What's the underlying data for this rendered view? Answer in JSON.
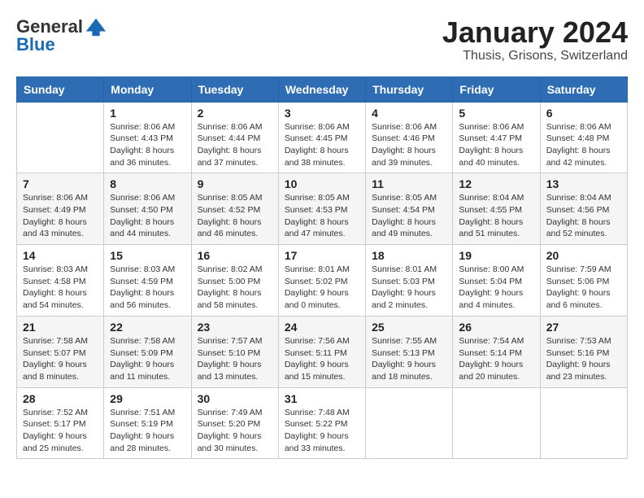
{
  "header": {
    "logo_general": "General",
    "logo_blue": "Blue",
    "month_title": "January 2024",
    "subtitle": "Thusis, Grisons, Switzerland"
  },
  "days_of_week": [
    "Sunday",
    "Monday",
    "Tuesday",
    "Wednesday",
    "Thursday",
    "Friday",
    "Saturday"
  ],
  "weeks": [
    [
      {
        "day": "",
        "sunrise": "",
        "sunset": "",
        "daylight": ""
      },
      {
        "day": "1",
        "sunrise": "Sunrise: 8:06 AM",
        "sunset": "Sunset: 4:43 PM",
        "daylight": "Daylight: 8 hours and 36 minutes."
      },
      {
        "day": "2",
        "sunrise": "Sunrise: 8:06 AM",
        "sunset": "Sunset: 4:44 PM",
        "daylight": "Daylight: 8 hours and 37 minutes."
      },
      {
        "day": "3",
        "sunrise": "Sunrise: 8:06 AM",
        "sunset": "Sunset: 4:45 PM",
        "daylight": "Daylight: 8 hours and 38 minutes."
      },
      {
        "day": "4",
        "sunrise": "Sunrise: 8:06 AM",
        "sunset": "Sunset: 4:46 PM",
        "daylight": "Daylight: 8 hours and 39 minutes."
      },
      {
        "day": "5",
        "sunrise": "Sunrise: 8:06 AM",
        "sunset": "Sunset: 4:47 PM",
        "daylight": "Daylight: 8 hours and 40 minutes."
      },
      {
        "day": "6",
        "sunrise": "Sunrise: 8:06 AM",
        "sunset": "Sunset: 4:48 PM",
        "daylight": "Daylight: 8 hours and 42 minutes."
      }
    ],
    [
      {
        "day": "7",
        "sunrise": "Sunrise: 8:06 AM",
        "sunset": "Sunset: 4:49 PM",
        "daylight": "Daylight: 8 hours and 43 minutes."
      },
      {
        "day": "8",
        "sunrise": "Sunrise: 8:06 AM",
        "sunset": "Sunset: 4:50 PM",
        "daylight": "Daylight: 8 hours and 44 minutes."
      },
      {
        "day": "9",
        "sunrise": "Sunrise: 8:05 AM",
        "sunset": "Sunset: 4:52 PM",
        "daylight": "Daylight: 8 hours and 46 minutes."
      },
      {
        "day": "10",
        "sunrise": "Sunrise: 8:05 AM",
        "sunset": "Sunset: 4:53 PM",
        "daylight": "Daylight: 8 hours and 47 minutes."
      },
      {
        "day": "11",
        "sunrise": "Sunrise: 8:05 AM",
        "sunset": "Sunset: 4:54 PM",
        "daylight": "Daylight: 8 hours and 49 minutes."
      },
      {
        "day": "12",
        "sunrise": "Sunrise: 8:04 AM",
        "sunset": "Sunset: 4:55 PM",
        "daylight": "Daylight: 8 hours and 51 minutes."
      },
      {
        "day": "13",
        "sunrise": "Sunrise: 8:04 AM",
        "sunset": "Sunset: 4:56 PM",
        "daylight": "Daylight: 8 hours and 52 minutes."
      }
    ],
    [
      {
        "day": "14",
        "sunrise": "Sunrise: 8:03 AM",
        "sunset": "Sunset: 4:58 PM",
        "daylight": "Daylight: 8 hours and 54 minutes."
      },
      {
        "day": "15",
        "sunrise": "Sunrise: 8:03 AM",
        "sunset": "Sunset: 4:59 PM",
        "daylight": "Daylight: 8 hours and 56 minutes."
      },
      {
        "day": "16",
        "sunrise": "Sunrise: 8:02 AM",
        "sunset": "Sunset: 5:00 PM",
        "daylight": "Daylight: 8 hours and 58 minutes."
      },
      {
        "day": "17",
        "sunrise": "Sunrise: 8:01 AM",
        "sunset": "Sunset: 5:02 PM",
        "daylight": "Daylight: 9 hours and 0 minutes."
      },
      {
        "day": "18",
        "sunrise": "Sunrise: 8:01 AM",
        "sunset": "Sunset: 5:03 PM",
        "daylight": "Daylight: 9 hours and 2 minutes."
      },
      {
        "day": "19",
        "sunrise": "Sunrise: 8:00 AM",
        "sunset": "Sunset: 5:04 PM",
        "daylight": "Daylight: 9 hours and 4 minutes."
      },
      {
        "day": "20",
        "sunrise": "Sunrise: 7:59 AM",
        "sunset": "Sunset: 5:06 PM",
        "daylight": "Daylight: 9 hours and 6 minutes."
      }
    ],
    [
      {
        "day": "21",
        "sunrise": "Sunrise: 7:58 AM",
        "sunset": "Sunset: 5:07 PM",
        "daylight": "Daylight: 9 hours and 8 minutes."
      },
      {
        "day": "22",
        "sunrise": "Sunrise: 7:58 AM",
        "sunset": "Sunset: 5:09 PM",
        "daylight": "Daylight: 9 hours and 11 minutes."
      },
      {
        "day": "23",
        "sunrise": "Sunrise: 7:57 AM",
        "sunset": "Sunset: 5:10 PM",
        "daylight": "Daylight: 9 hours and 13 minutes."
      },
      {
        "day": "24",
        "sunrise": "Sunrise: 7:56 AM",
        "sunset": "Sunset: 5:11 PM",
        "daylight": "Daylight: 9 hours and 15 minutes."
      },
      {
        "day": "25",
        "sunrise": "Sunrise: 7:55 AM",
        "sunset": "Sunset: 5:13 PM",
        "daylight": "Daylight: 9 hours and 18 minutes."
      },
      {
        "day": "26",
        "sunrise": "Sunrise: 7:54 AM",
        "sunset": "Sunset: 5:14 PM",
        "daylight": "Daylight: 9 hours and 20 minutes."
      },
      {
        "day": "27",
        "sunrise": "Sunrise: 7:53 AM",
        "sunset": "Sunset: 5:16 PM",
        "daylight": "Daylight: 9 hours and 23 minutes."
      }
    ],
    [
      {
        "day": "28",
        "sunrise": "Sunrise: 7:52 AM",
        "sunset": "Sunset: 5:17 PM",
        "daylight": "Daylight: 9 hours and 25 minutes."
      },
      {
        "day": "29",
        "sunrise": "Sunrise: 7:51 AM",
        "sunset": "Sunset: 5:19 PM",
        "daylight": "Daylight: 9 hours and 28 minutes."
      },
      {
        "day": "30",
        "sunrise": "Sunrise: 7:49 AM",
        "sunset": "Sunset: 5:20 PM",
        "daylight": "Daylight: 9 hours and 30 minutes."
      },
      {
        "day": "31",
        "sunrise": "Sunrise: 7:48 AM",
        "sunset": "Sunset: 5:22 PM",
        "daylight": "Daylight: 9 hours and 33 minutes."
      },
      {
        "day": "",
        "sunrise": "",
        "sunset": "",
        "daylight": ""
      },
      {
        "day": "",
        "sunrise": "",
        "sunset": "",
        "daylight": ""
      },
      {
        "day": "",
        "sunrise": "",
        "sunset": "",
        "daylight": ""
      }
    ]
  ]
}
